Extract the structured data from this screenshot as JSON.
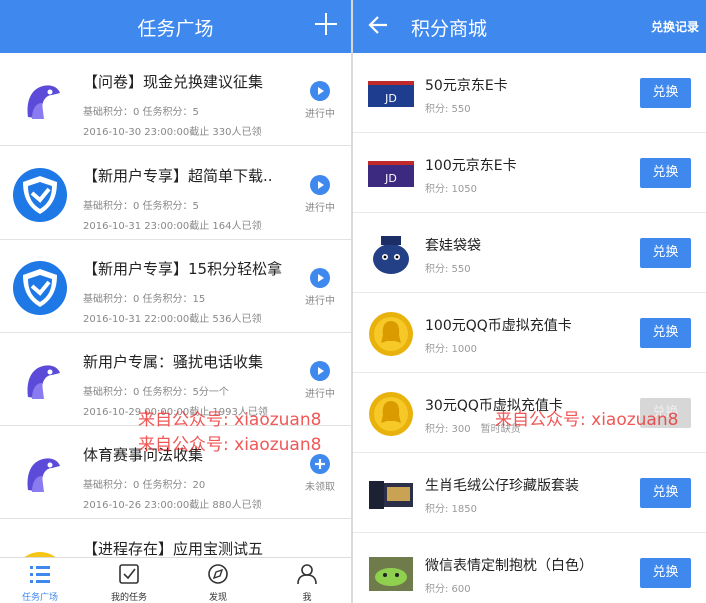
{
  "left": {
    "title": "任务广场",
    "tasks": [
      {
        "name": "【问卷】现金兑换建议征集",
        "meta1": "基础积分：0    任务积分：5",
        "meta2": "2016-10-30 23:00:00截止    330人已领",
        "status": "进行中",
        "avatar": "penguin"
      },
      {
        "name": "【新用户专享】超简单下载..",
        "meta1": "基础积分：0    任务积分：5",
        "meta2": "2016-10-31 23:00:00截止    164人已领",
        "status": "进行中",
        "avatar": "shield"
      },
      {
        "name": "【新用户专享】15积分轻松拿",
        "meta1": "基础积分：0    任务积分：15",
        "meta2": "2016-10-31 22:00:00截止    536人已领",
        "status": "进行中",
        "avatar": "shield"
      },
      {
        "name": "新用户专属：骚扰电话收集",
        "meta1": "基础积分：0    任务积分：5分一个",
        "meta2": "2016-10-29 00:00:00截止    1993人已领",
        "status": "进行中",
        "avatar": "penguin"
      },
      {
        "name": "体育赛事问法收集",
        "meta1": "基础积分：0    任务积分：20",
        "meta2": "2016-10-26 23:00:00截止    880人已领",
        "status": "未领取",
        "avatar": "penguin"
      },
      {
        "name": "【进程存在】应用宝测试五",
        "meta1": "",
        "meta2": "",
        "status": "",
        "avatar": "penguin"
      }
    ],
    "tabs": [
      {
        "label": "任务广场"
      },
      {
        "label": "我的任务"
      },
      {
        "label": "发现"
      },
      {
        "label": "我"
      }
    ]
  },
  "right": {
    "title": "积分商城",
    "record": "兑换记录",
    "items": [
      {
        "name": "50元京东E卡",
        "points": "积分: 550",
        "button": "兑换",
        "note": ""
      },
      {
        "name": "100元京东E卡",
        "points": "积分: 1050",
        "button": "兑换",
        "note": ""
      },
      {
        "name": "套娃袋袋",
        "points": "积分: 550",
        "button": "兑换",
        "note": ""
      },
      {
        "name": "100元QQ币虚拟充值卡",
        "points": "积分: 1000",
        "button": "兑换",
        "note": ""
      },
      {
        "name": "30元QQ币虚拟充值卡",
        "points": "积分: 300",
        "button": "兑换",
        "note": "暂时缺货"
      },
      {
        "name": "生肖毛绒公仔珍藏版套装",
        "points": "积分: 1850",
        "button": "兑换",
        "note": ""
      },
      {
        "name": "微信表情定制抱枕（白色）",
        "points": "积分: 600",
        "button": "兑换",
        "note": ""
      }
    ]
  },
  "watermark": {
    "text": "来自公众号: xiaozuan8"
  },
  "colors": {
    "accent": "#3e88ee",
    "watermark": "#ec2828"
  }
}
